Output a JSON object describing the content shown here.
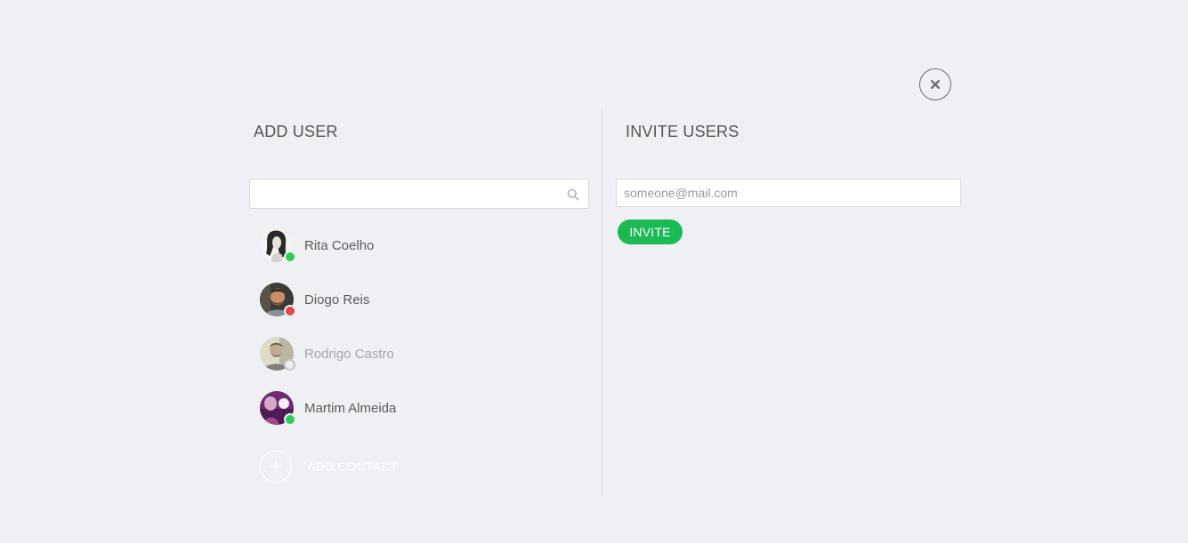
{
  "close_button": {
    "icon": "close-icon",
    "color": "#6e6e6e"
  },
  "add_user": {
    "title": "ADD USER",
    "search": {
      "value": "",
      "placeholder": "",
      "icon": "search-icon"
    },
    "users": [
      {
        "name": "Rita Coelho",
        "status": "online"
      },
      {
        "name": "Diogo Reis",
        "status": "busy"
      },
      {
        "name": "Rodrigo Castro",
        "status": "offline"
      },
      {
        "name": "Martim Almeida",
        "status": "online"
      }
    ],
    "add_contact_label": "ADD CONTACT"
  },
  "invite_users": {
    "title": "INVITE USERS",
    "email": {
      "value": "",
      "placeholder": "someone@mail.com"
    },
    "invite_label": "INVITE"
  },
  "colors": {
    "background": "#eff0f4",
    "accent": "#1db954",
    "online": "#2ecc5a",
    "busy": "#e04848"
  }
}
